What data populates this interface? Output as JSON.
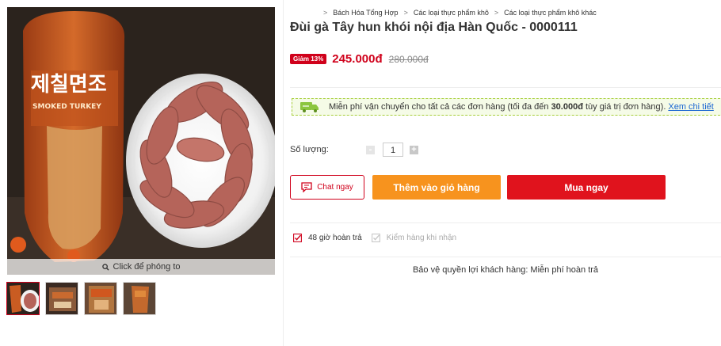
{
  "gallery": {
    "zoom_hint": "Click để phóng to",
    "package_brand_text": "제칠면조",
    "package_sub_text": "SMOKED TURKEY",
    "thumb_count": 4
  },
  "breadcrumb": [
    "Bách Hóa Tổng Hợp",
    "Các loại thực phẩm khô",
    "Các loại thực phẩm khô khác"
  ],
  "breadcrumb_separator": ">",
  "product": {
    "title": "Đùi gà Tây hun khói nội địa Hàn Quốc - 0000111",
    "discount_badge": "Giảm 13%",
    "price": "245.000đ",
    "old_price": "280.000đ"
  },
  "shipping": {
    "text_before": "Miễn phí vận chuyển cho tất cả các đơn hàng (tối đa đến ",
    "amount": "30.000đ",
    "text_after": " tùy giá trị đơn hàng).",
    "link": "Xem chi tiết"
  },
  "quantity": {
    "label": "Số lượng:",
    "value": "1",
    "minus": "-",
    "plus": "+"
  },
  "actions": {
    "chat": "Chat ngay",
    "add_to_cart": "Thêm vào giỏ hàng",
    "buy_now": "Mua ngay"
  },
  "guarantees": {
    "return": "48 giờ hoàn trả",
    "inspect": "Kiểm hàng khi nhận"
  },
  "protection": "Bảo vệ quyền lợi khách hàng: Miễn phí hoàn trả",
  "colors": {
    "accent_red": "#d0011b",
    "buy_red": "#e0131d",
    "cart_orange": "#f7931e",
    "link_blue": "#1a66d2",
    "shipping_green": "#a6ce39"
  }
}
